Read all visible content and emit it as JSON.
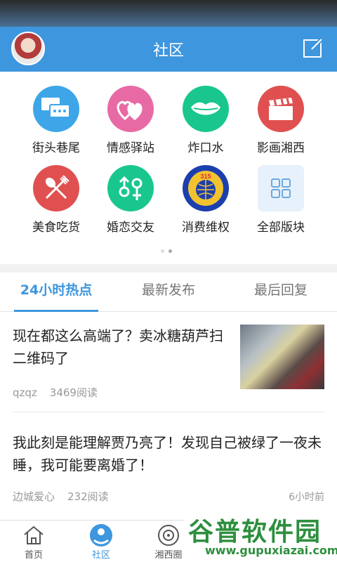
{
  "header": {
    "title": "社区"
  },
  "categories": [
    {
      "label": "街头巷尾",
      "icon": "chat-bubbles-icon",
      "color": "#3ea6e8"
    },
    {
      "label": "情感驿站",
      "icon": "hearts-icon",
      "color": "#e86aa4"
    },
    {
      "label": "炸口水",
      "icon": "lips-icon",
      "color": "#19c78e"
    },
    {
      "label": "影画湘西",
      "icon": "clapperboard-icon",
      "color": "#e05050"
    },
    {
      "label": "美食吃货",
      "icon": "fork-spoon-icon",
      "color": "#e05050"
    },
    {
      "label": "婚恋交友",
      "icon": "gender-symbols-icon",
      "color": "#19c78e"
    },
    {
      "label": "消费维权",
      "icon": "consumer-315-logo-icon",
      "color": "#1c3fae"
    },
    {
      "label": "全部版块",
      "icon": "grid-icon",
      "color": "#e7f1fb"
    }
  ],
  "tabs": [
    {
      "label": "24小时热点",
      "active": true
    },
    {
      "label": "最新发布",
      "active": false
    },
    {
      "label": "最后回复",
      "active": false
    }
  ],
  "posts": [
    {
      "title": "现在都这么高端了？卖冰糖葫芦扫二维码了",
      "author": "qzqz",
      "reads": "3469阅读",
      "time": ""
    },
    {
      "title": "我此刻是能理解贾乃亮了！发现自己被绿了一夜未睡，我可能要离婚了！",
      "author": "边城爱心",
      "reads": "232阅读",
      "time": "6小时前"
    }
  ],
  "bottom_nav": [
    {
      "label": "首页",
      "icon": "home-icon",
      "active": false
    },
    {
      "label": "社区",
      "icon": "community-icon",
      "active": true
    },
    {
      "label": "湘西圈",
      "icon": "circle-icon",
      "active": false
    },
    {
      "label": "",
      "icon": "discover-icon",
      "active": false
    },
    {
      "label": "",
      "icon": "profile-icon",
      "active": false
    }
  ],
  "watermark": {
    "text": "谷普软件园",
    "url": "www.gupuxiazai.com"
  },
  "colors": {
    "primary": "#3d96de"
  }
}
